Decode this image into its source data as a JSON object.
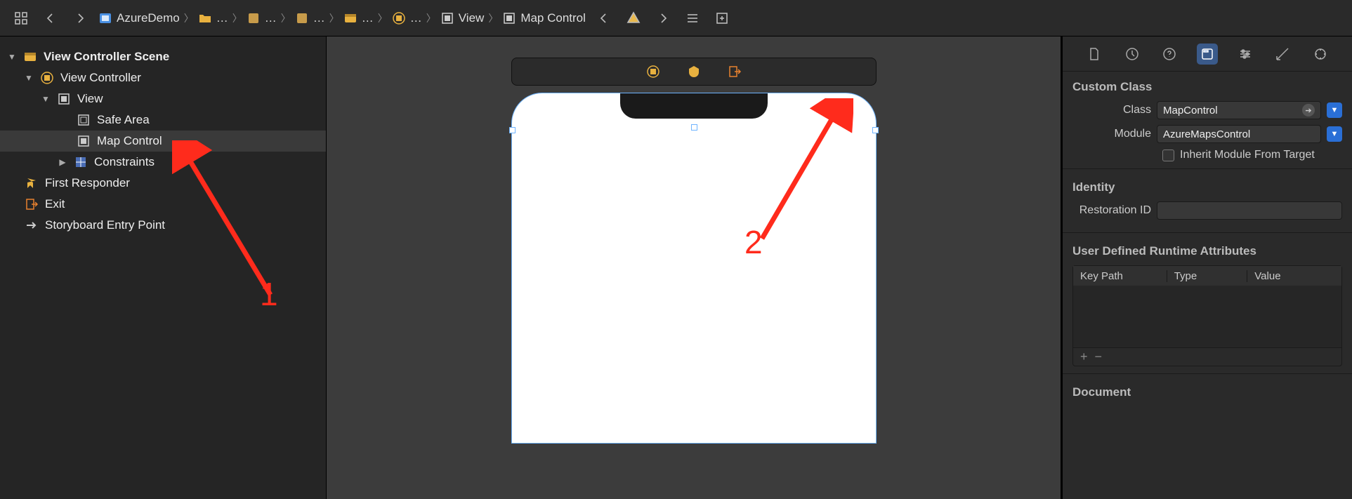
{
  "breadcrumb": {
    "project": "AzureDemo",
    "items": [
      "…",
      "…",
      "…",
      "…",
      "…",
      "View",
      "Map Control"
    ]
  },
  "outline": {
    "scene": "View Controller Scene",
    "vc": "View Controller",
    "view": "View",
    "safe_area": "Safe Area",
    "map_control": "Map Control",
    "constraints": "Constraints",
    "first_responder": "First Responder",
    "exit": "Exit",
    "entry_point": "Storyboard Entry Point"
  },
  "inspector": {
    "custom_class_header": "Custom Class",
    "class_label": "Class",
    "class_value": "MapControl",
    "module_label": "Module",
    "module_value": "AzureMapsControl",
    "inherit_label": "Inherit Module From Target",
    "identity_header": "Identity",
    "restoration_label": "Restoration ID",
    "restoration_value": "",
    "udra_header": "User Defined Runtime Attributes",
    "cols": {
      "key": "Key Path",
      "type": "Type",
      "value": "Value"
    },
    "document_header": "Document"
  },
  "annotations": {
    "one": "1",
    "two": "2"
  }
}
